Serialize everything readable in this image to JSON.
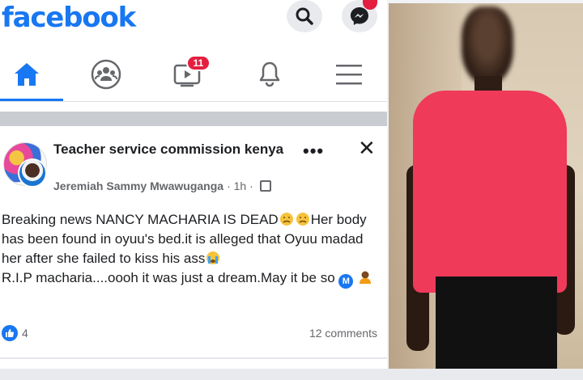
{
  "app": {
    "logo_text": "facebook"
  },
  "top_icons": {
    "search": "search-icon",
    "messenger": "messenger-icon"
  },
  "nav": {
    "tabs": [
      {
        "name": "home",
        "icon": "home-icon",
        "active": true
      },
      {
        "name": "groups",
        "icon": "groups-icon"
      },
      {
        "name": "watch",
        "icon": "watch-icon",
        "badge": "11"
      },
      {
        "name": "notifications",
        "icon": "bell-icon"
      },
      {
        "name": "menu",
        "icon": "menu-icon"
      }
    ]
  },
  "post": {
    "title": "Teacher service commission kenya",
    "author": "Jeremiah Sammy Mwawuganga",
    "time": "· 1h ·",
    "text_line1": "Breaking news NANCY MACHARIA IS DEAD",
    "text_after_emoji": "Her body has been found in oyuu's bed.it is alleged that Oyuu madad her after she failed to kiss his ass",
    "text_line3": "R.I.P macharia....oooh it was just a dream.May it be so",
    "m_badge": "M",
    "like_count": "4",
    "comments": "12 comments"
  },
  "colors": {
    "brand": "#1877f2",
    "badge": "#e41e3f",
    "shirt": "#ef3a5a"
  }
}
